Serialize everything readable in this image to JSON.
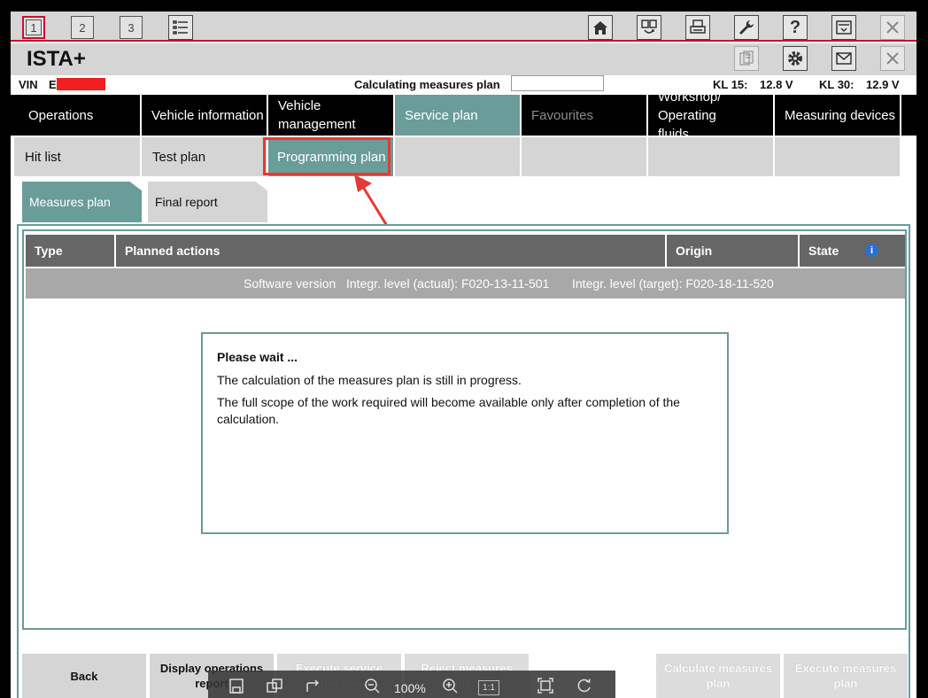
{
  "toolbar": {
    "sessions": [
      "1",
      "2",
      "3"
    ],
    "icons": [
      "list-icon",
      "home-icon",
      "transfer-icon",
      "print-icon",
      "wrench-icon",
      "help-icon",
      "download-icon",
      "close-icon"
    ]
  },
  "titlebar": {
    "title": "ISTA+",
    "icons": [
      "clipboard-icon",
      "gear-icon",
      "mail-icon",
      "close-icon"
    ]
  },
  "info": {
    "vin_label": "VIN",
    "vin_prefix": "E",
    "calc_label": "Calculating measures plan",
    "kl15_label": "KL 15:",
    "kl15_value": "12.8 V",
    "kl30_label": "KL 30:",
    "kl30_value": "12.9 V"
  },
  "main_tabs": [
    {
      "label": "Operations"
    },
    {
      "label": "Vehicle information"
    },
    {
      "label": "Vehicle management"
    },
    {
      "label": "Service plan"
    },
    {
      "label": "Favourites"
    },
    {
      "label": "Workshop/ Operating fluids"
    },
    {
      "label": "Measuring devices"
    }
  ],
  "sub_tabs": [
    {
      "label": "Hit list"
    },
    {
      "label": "Test plan"
    },
    {
      "label": "Programming plan"
    },
    {
      "label": ""
    },
    {
      "label": ""
    },
    {
      "label": ""
    },
    {
      "label": ""
    }
  ],
  "measure_tabs": [
    {
      "label": "Measures plan"
    },
    {
      "label": "Final report"
    }
  ],
  "table": {
    "headers": [
      "Type",
      "Planned actions",
      "Origin",
      "State"
    ],
    "info_icon": "i",
    "software_label": "Software version",
    "actual": "Integr. level (actual): F020-13-11-501",
    "target": "Integr. level (target): F020-18-11-520"
  },
  "dialog": {
    "title": "Please wait ...",
    "line1": "The calculation of the measures plan is still in progress.",
    "line2": "The full scope of the work required will become available only after completion of the calculation."
  },
  "buttons": {
    "back": "Back",
    "display_ops": "Display operations report",
    "exec_service": "Execute service function",
    "reject": "Reject measures plan",
    "calc": "Calculate measures plan",
    "exec_plan": "Execute measures plan"
  },
  "viewer": {
    "zoom": "100%",
    "actual_size": "1:1"
  },
  "colors": {
    "accent": "#6a9c9a",
    "highlight": "#e53935",
    "header_bg": "#666666"
  }
}
